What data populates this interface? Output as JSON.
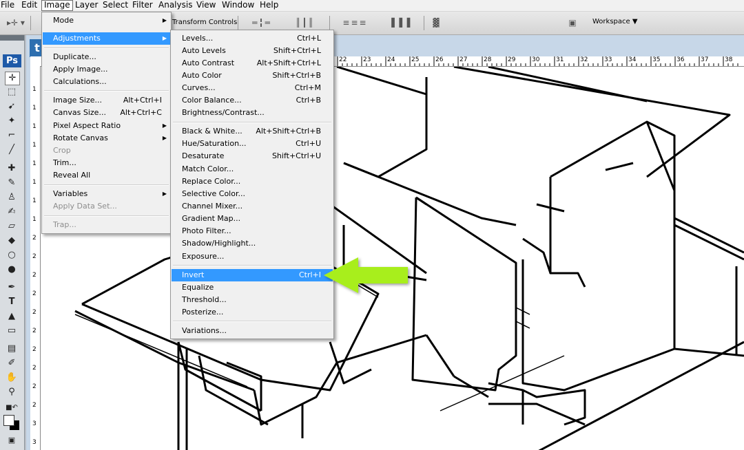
{
  "menubar": {
    "items": [
      "File",
      "Edit",
      "Image",
      "Layer",
      "Select",
      "Filter",
      "Analysis",
      "View",
      "Window",
      "Help"
    ]
  },
  "options_bar": {
    "transform_label": "Transform Controls",
    "workspace_label": "Workspace"
  },
  "toolbox": {
    "logo": "Ps",
    "tools": [
      "move-tool",
      "marquee-tool",
      "lasso-tool",
      "quick-selection-tool",
      "crop-tool",
      "slice-tool",
      "healing-brush-tool",
      "brush-tool",
      "clone-stamp-tool",
      "history-brush-tool",
      "eraser-tool",
      "paint-bucket-tool",
      "blur-tool",
      "dodge-tool",
      "pen-tool",
      "type-tool",
      "path-selection-tool",
      "rectangle-tool",
      "notes-tool",
      "eyedropper-tool",
      "hand-tool",
      "zoom-tool"
    ]
  },
  "document": {
    "tab_label": "t",
    "ruler_numbers": [
      "22",
      "23",
      "24",
      "25",
      "26",
      "27",
      "28",
      "29",
      "30",
      "31",
      "32",
      "33",
      "34",
      "35",
      "36",
      "37",
      "38"
    ],
    "vruler_numbers": [
      "1",
      "1",
      "1",
      "1",
      "1",
      "1",
      "1",
      "1",
      "2",
      "2",
      "2",
      "2",
      "2",
      "2",
      "2",
      "2",
      "2",
      "2",
      "3",
      "3"
    ]
  },
  "image_menu": {
    "items": [
      {
        "label": "Mode",
        "shortcut": "",
        "submenu": true,
        "disabled": false,
        "highlighted": false
      },
      {
        "label": "Adjustments",
        "shortcut": "",
        "submenu": true,
        "disabled": false,
        "highlighted": true
      },
      {
        "label": "Duplicate...",
        "shortcut": "",
        "submenu": false,
        "disabled": false,
        "highlighted": false
      },
      {
        "label": "Apply Image...",
        "shortcut": "",
        "submenu": false,
        "disabled": false,
        "highlighted": false
      },
      {
        "label": "Calculations...",
        "shortcut": "",
        "submenu": false,
        "disabled": false,
        "highlighted": false
      },
      {
        "label": "Image Size...",
        "shortcut": "Alt+Ctrl+I",
        "submenu": false,
        "disabled": false,
        "highlighted": false
      },
      {
        "label": "Canvas Size...",
        "shortcut": "Alt+Ctrl+C",
        "submenu": false,
        "disabled": false,
        "highlighted": false
      },
      {
        "label": "Pixel Aspect Ratio",
        "shortcut": "",
        "submenu": true,
        "disabled": false,
        "highlighted": false
      },
      {
        "label": "Rotate Canvas",
        "shortcut": "",
        "submenu": true,
        "disabled": false,
        "highlighted": false
      },
      {
        "label": "Crop",
        "shortcut": "",
        "submenu": false,
        "disabled": true,
        "highlighted": false
      },
      {
        "label": "Trim...",
        "shortcut": "",
        "submenu": false,
        "disabled": false,
        "highlighted": false
      },
      {
        "label": "Reveal All",
        "shortcut": "",
        "submenu": false,
        "disabled": false,
        "highlighted": false
      },
      {
        "label": "Variables",
        "shortcut": "",
        "submenu": true,
        "disabled": false,
        "highlighted": false
      },
      {
        "label": "Apply Data Set...",
        "shortcut": "",
        "submenu": false,
        "disabled": true,
        "highlighted": false
      },
      {
        "label": "Trap...",
        "shortcut": "",
        "submenu": false,
        "disabled": true,
        "highlighted": false
      }
    ]
  },
  "adjustments_menu": {
    "items": [
      {
        "label": "Levels...",
        "shortcut": "Ctrl+L",
        "highlighted": false
      },
      {
        "label": "Auto Levels",
        "shortcut": "Shift+Ctrl+L",
        "highlighted": false
      },
      {
        "label": "Auto Contrast",
        "shortcut": "Alt+Shift+Ctrl+L",
        "highlighted": false
      },
      {
        "label": "Auto Color",
        "shortcut": "Shift+Ctrl+B",
        "highlighted": false
      },
      {
        "label": "Curves...",
        "shortcut": "Ctrl+M",
        "highlighted": false
      },
      {
        "label": "Color Balance...",
        "shortcut": "Ctrl+B",
        "highlighted": false
      },
      {
        "label": "Brightness/Contrast...",
        "shortcut": "",
        "highlighted": false
      },
      {
        "label": "Black & White...",
        "shortcut": "Alt+Shift+Ctrl+B",
        "highlighted": false
      },
      {
        "label": "Hue/Saturation...",
        "shortcut": "Ctrl+U",
        "highlighted": false
      },
      {
        "label": "Desaturate",
        "shortcut": "Shift+Ctrl+U",
        "highlighted": false
      },
      {
        "label": "Match Color...",
        "shortcut": "",
        "highlighted": false
      },
      {
        "label": "Replace Color...",
        "shortcut": "",
        "highlighted": false
      },
      {
        "label": "Selective Color...",
        "shortcut": "",
        "highlighted": false
      },
      {
        "label": "Channel Mixer...",
        "shortcut": "",
        "highlighted": false
      },
      {
        "label": "Gradient Map...",
        "shortcut": "",
        "highlighted": false
      },
      {
        "label": "Photo Filter...",
        "shortcut": "",
        "highlighted": false
      },
      {
        "label": "Shadow/Highlight...",
        "shortcut": "",
        "highlighted": false
      },
      {
        "label": "Exposure...",
        "shortcut": "",
        "highlighted": false
      },
      {
        "label": "Invert",
        "shortcut": "Ctrl+I",
        "highlighted": true
      },
      {
        "label": "Equalize",
        "shortcut": "",
        "highlighted": false
      },
      {
        "label": "Threshold...",
        "shortcut": "",
        "highlighted": false
      },
      {
        "label": "Posterize...",
        "shortcut": "",
        "highlighted": false
      },
      {
        "label": "Variations...",
        "shortcut": "",
        "highlighted": false
      }
    ]
  },
  "colors": {
    "highlight": "#3399ff",
    "arrow": "#a8ee1e",
    "menu_bg": "#f0f0f0"
  }
}
